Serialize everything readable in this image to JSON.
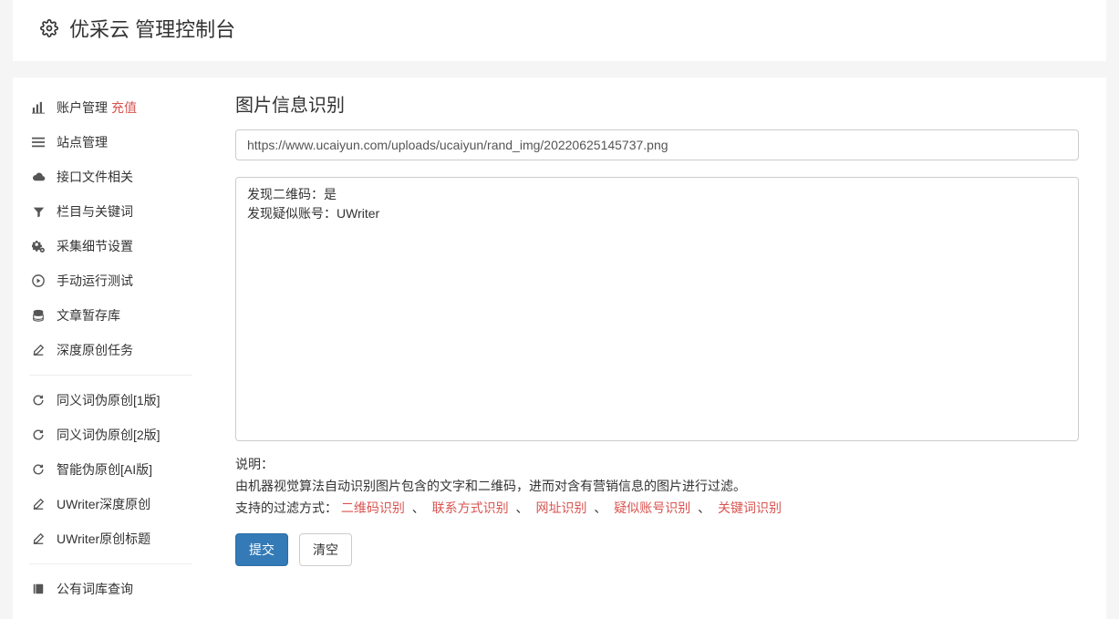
{
  "header": {
    "title": "优采云 管理控制台"
  },
  "sidebar": {
    "group1": [
      {
        "icon": "bar-chart",
        "label": "账户管理",
        "tag": "充值"
      },
      {
        "icon": "list",
        "label": "站点管理"
      },
      {
        "icon": "cloud",
        "label": "接口文件相关"
      },
      {
        "icon": "filter",
        "label": "栏目与关键词"
      },
      {
        "icon": "gears",
        "label": "采集细节设置"
      },
      {
        "icon": "play",
        "label": "手动运行测试"
      },
      {
        "icon": "database",
        "label": "文章暂存库"
      },
      {
        "icon": "edit",
        "label": "深度原创任务"
      }
    ],
    "group2": [
      {
        "icon": "refresh",
        "label": "同义词伪原创[1版]"
      },
      {
        "icon": "refresh",
        "label": "同义词伪原创[2版]"
      },
      {
        "icon": "refresh",
        "label": "智能伪原创[AI版]"
      },
      {
        "icon": "edit",
        "label": "UWriter深度原创"
      },
      {
        "icon": "edit",
        "label": "UWriter原创标题"
      }
    ],
    "group3": [
      {
        "icon": "book",
        "label": "公有词库查询"
      }
    ]
  },
  "main": {
    "title": "图片信息识别",
    "url_value": "https://www.ucaiyun.com/uploads/ucaiyun/rand_img/20220625145737.png",
    "result_text": "发现二维码：是\n发现疑似账号：UWriter",
    "desc_label": "说明：",
    "desc_line1": "由机器视觉算法自动识别图片包含的文字和二维码，进而对含有营销信息的图片进行过滤。",
    "desc_prefix": "支持的过滤方式：",
    "filters": [
      "二维码识别",
      "联系方式识别",
      "网址识别",
      "疑似账号识别",
      "关键词识别"
    ],
    "filter_sep": "、",
    "submit_label": "提交",
    "clear_label": "清空"
  }
}
